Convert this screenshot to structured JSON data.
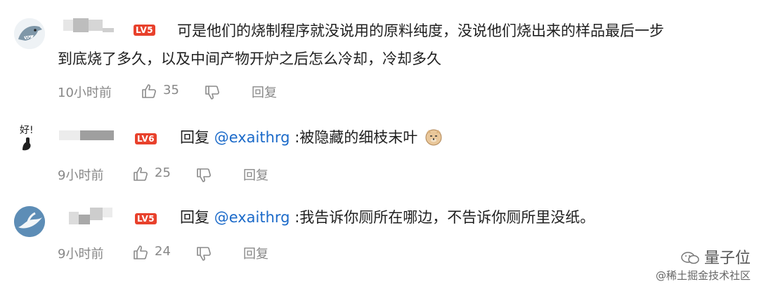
{
  "comments": [
    {
      "level": "LV5",
      "level_color": "#e8412c",
      "line1": "可是他们的烧制程序就没说用的原料纯度，没说他们烧出来的样品最后一步",
      "line2": "到底烧了多久，以及中间产物开炉之后怎么冷却，冷却多久",
      "time": "10小时前",
      "likes": "35",
      "reply_label": "回复"
    },
    {
      "level": "LV6",
      "level_color": "#e8412c",
      "reply_prefix": "回复 ",
      "mention": "@exaithrg",
      "text": " :被隐藏的细枝末叶",
      "avatar_text": "好!",
      "time": "9小时前",
      "likes": "25",
      "reply_label": "回复"
    },
    {
      "level": "LV5",
      "level_color": "#e8412c",
      "reply_prefix": "回复 ",
      "mention": "@exaithrg",
      "text": " :我告诉你厕所在哪边，不告诉你厕所里没纸。",
      "time": "9小时前",
      "likes": "24",
      "reply_label": "回复"
    }
  ],
  "watermark": {
    "brand": "量子位",
    "community": "@稀土掘金技术社区"
  },
  "colors": {
    "mention": "#1b6ac9",
    "meta_text": "#888888"
  }
}
